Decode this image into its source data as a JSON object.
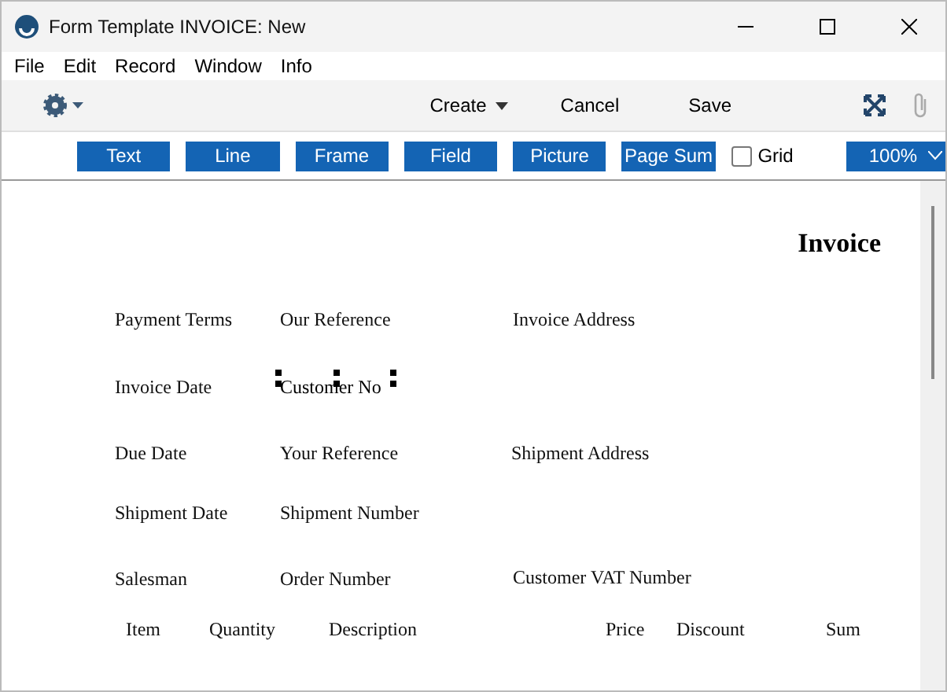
{
  "window": {
    "title": "Form Template INVOICE: New"
  },
  "menu": [
    "File",
    "Edit",
    "Record",
    "Window",
    "Info"
  ],
  "toolbar": {
    "buttons": [
      "Create",
      "Cancel",
      "Save"
    ]
  },
  "tools": [
    "Text",
    "Line",
    "Frame",
    "Field",
    "Picture",
    "Page Sum"
  ],
  "grid": {
    "label": "Grid",
    "checked": false
  },
  "zoom": {
    "value": "100%"
  },
  "form": {
    "title": "Invoice",
    "fields": [
      {
        "label": "Payment Terms",
        "selected": false
      },
      {
        "label": "Our Reference",
        "selected": false
      },
      {
        "label": "Invoice Address",
        "selected": false
      },
      {
        "label": "Invoice Date",
        "selected": false
      },
      {
        "label": "Customer No",
        "selected": true
      },
      {
        "label": "Due Date",
        "selected": false
      },
      {
        "label": "Your Reference",
        "selected": false
      },
      {
        "label": "Shipment Address",
        "selected": false
      },
      {
        "label": "Shipment Date",
        "selected": false
      },
      {
        "label": "Shipment Number",
        "selected": false
      },
      {
        "label": "Salesman",
        "selected": false
      },
      {
        "label": "Order Number",
        "selected": false
      },
      {
        "label": "Customer VAT Number",
        "selected": false
      },
      {
        "label": "Item",
        "selected": false
      },
      {
        "label": "Quantity",
        "selected": false
      },
      {
        "label": "Description",
        "selected": false
      },
      {
        "label": "Price",
        "selected": false
      },
      {
        "label": "Discount",
        "selected": false
      },
      {
        "label": "Sum",
        "selected": false
      }
    ]
  }
}
